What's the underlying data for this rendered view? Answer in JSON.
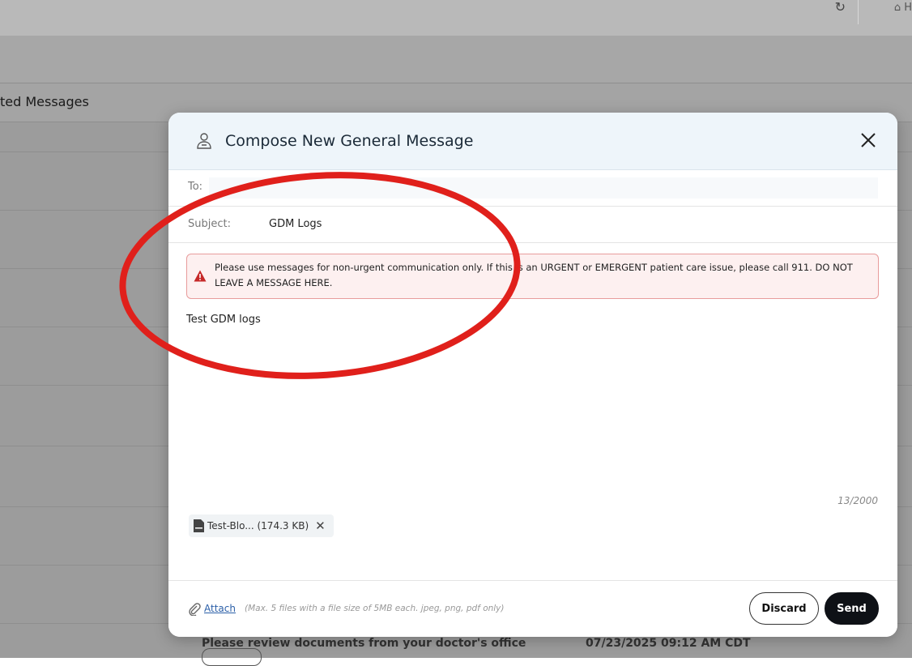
{
  "background": {
    "section_title": "ted Messages",
    "home_label": "H",
    "footer_message": "Please review documents from your doctor's office",
    "footer_date": "07/23/2025 09:12 AM CDT"
  },
  "modal": {
    "title": "Compose New General Message",
    "to_label": "To:",
    "to_value": "",
    "subject_label": "Subject:",
    "subject_value": "GDM Logs",
    "warning_text": "Please use messages for non-urgent communication only. If this is an URGENT or EMERGENT patient care issue, please call 911. DO NOT LEAVE A MESSAGE HERE.",
    "body_text": "Test GDM logs",
    "char_counter": "13/2000",
    "attachment": {
      "name": "Test-Blo... (174.3 KB)"
    },
    "footer": {
      "attach_label": "Attach",
      "attach_hint": "(Max. 5 files with a file size of 5MB each. jpeg, png, pdf only)",
      "discard_label": "Discard",
      "send_label": "Send"
    }
  },
  "colors": {
    "annotation": "#e0201b",
    "send_bg": "#0e1116",
    "header_bg": "#eef5fa",
    "warning_border": "#e89c9c",
    "link": "#2b5fa8"
  },
  "icons": [
    "history-icon",
    "home-icon",
    "person-icon",
    "close-icon",
    "warning-icon",
    "file-icon",
    "remove-icon",
    "paperclip-icon"
  ]
}
